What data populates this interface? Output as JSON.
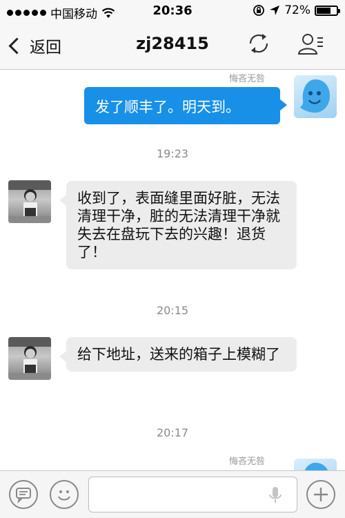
{
  "status": {
    "carrier": "中国移动",
    "time": "20:36",
    "battery": "72%",
    "battery_level": 0.72
  },
  "header": {
    "back_label": "返回",
    "title": "zj28415"
  },
  "messages": [
    {
      "nick": "悔吝无咎",
      "text": "发了顺丰了。明天到。"
    },
    {
      "time": "19:23"
    },
    {
      "text": "收到了，表面缝里面好脏，无法清理干净，脏的无法清理干净就失去在盘玩下去的兴趣！退货了！"
    },
    {
      "time": "20:15"
    },
    {
      "text": "给下地址，送来的箱子上模糊了"
    },
    {
      "time": "20:17"
    },
    {
      "nick": "悔吝无咎"
    }
  ],
  "icons": {
    "refresh": "refresh-icon",
    "contact": "contact-card-icon",
    "chat": "chat-bubble-icon",
    "emoji": "emoji-icon",
    "mic": "microphone-icon",
    "plus": "plus-icon"
  },
  "colors": {
    "outgoing_bubble": "#1890e8",
    "incoming_bubble": "#ececec"
  }
}
